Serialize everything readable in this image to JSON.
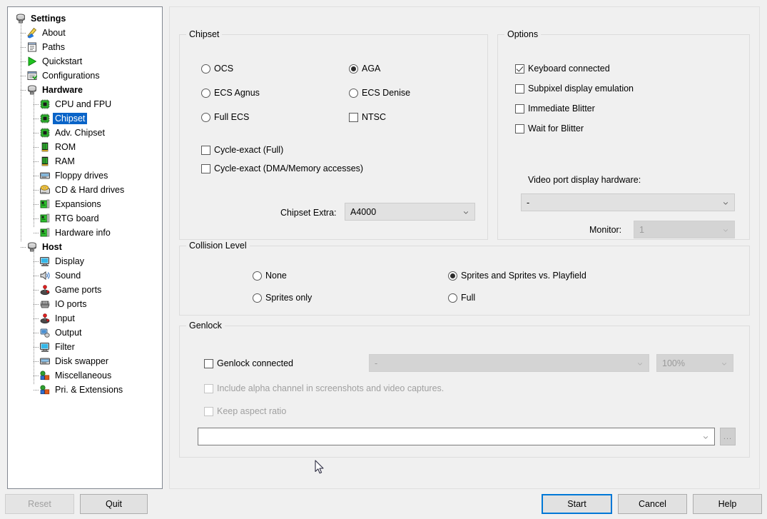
{
  "sidebar": {
    "nodes": [
      {
        "label": "Settings",
        "level": 0,
        "icon": "settings-stack-icon",
        "bold": true,
        "selected": false
      },
      {
        "label": "About",
        "level": 1,
        "icon": "about-pencil-icon",
        "bold": false,
        "selected": false
      },
      {
        "label": "Paths",
        "level": 1,
        "icon": "paths-icon",
        "bold": false,
        "selected": false
      },
      {
        "label": "Quickstart",
        "level": 1,
        "icon": "quickstart-play-icon",
        "bold": false,
        "selected": false
      },
      {
        "label": "Configurations",
        "level": 1,
        "icon": "configurations-icon",
        "bold": false,
        "selected": false
      },
      {
        "label": "Hardware",
        "level": 1,
        "icon": "hardware-stack-icon",
        "bold": true,
        "selected": false
      },
      {
        "label": "CPU and FPU",
        "level": 2,
        "icon": "chip-icon",
        "bold": false,
        "selected": false
      },
      {
        "label": "Chipset",
        "level": 2,
        "icon": "chip-icon",
        "bold": false,
        "selected": true
      },
      {
        "label": "Adv. Chipset",
        "level": 2,
        "icon": "chip-icon",
        "bold": false,
        "selected": false
      },
      {
        "label": "ROM",
        "level": 2,
        "icon": "memory-stick-icon",
        "bold": false,
        "selected": false
      },
      {
        "label": "RAM",
        "level": 2,
        "icon": "memory-stick-icon",
        "bold": false,
        "selected": false
      },
      {
        "label": "Floppy drives",
        "level": 2,
        "icon": "floppy-drive-icon",
        "bold": false,
        "selected": false
      },
      {
        "label": "CD & Hard drives",
        "level": 2,
        "icon": "cd-drive-icon",
        "bold": false,
        "selected": false
      },
      {
        "label": "Expansions",
        "level": 2,
        "icon": "expansion-card-icon",
        "bold": false,
        "selected": false
      },
      {
        "label": "RTG board",
        "level": 2,
        "icon": "expansion-card-icon",
        "bold": false,
        "selected": false
      },
      {
        "label": "Hardware info",
        "level": 2,
        "icon": "expansion-card-icon",
        "bold": false,
        "selected": false
      },
      {
        "label": "Host",
        "level": 1,
        "icon": "host-stack-icon",
        "bold": true,
        "selected": false
      },
      {
        "label": "Display",
        "level": 2,
        "icon": "monitor-icon",
        "bold": false,
        "selected": false
      },
      {
        "label": "Sound",
        "level": 2,
        "icon": "sound-icon",
        "bold": false,
        "selected": false
      },
      {
        "label": "Game ports",
        "level": 2,
        "icon": "joystick-icon",
        "bold": false,
        "selected": false
      },
      {
        "label": "IO ports",
        "level": 2,
        "icon": "io-ports-icon",
        "bold": false,
        "selected": false
      },
      {
        "label": "Input",
        "level": 2,
        "icon": "joystick-icon",
        "bold": false,
        "selected": false
      },
      {
        "label": "Output",
        "level": 2,
        "icon": "output-icon",
        "bold": false,
        "selected": false
      },
      {
        "label": "Filter",
        "level": 2,
        "icon": "monitor-icon",
        "bold": false,
        "selected": false
      },
      {
        "label": "Disk swapper",
        "level": 2,
        "icon": "floppy-drive-icon",
        "bold": false,
        "selected": false
      },
      {
        "label": "Miscellaneous",
        "level": 2,
        "icon": "blocks-icon",
        "bold": false,
        "selected": false
      },
      {
        "label": "Pri. & Extensions",
        "level": 2,
        "icon": "blocks-icon",
        "bold": false,
        "selected": false
      }
    ]
  },
  "chipset_group": {
    "title": "Chipset",
    "radios": [
      {
        "label": "OCS",
        "checked": false
      },
      {
        "label": "ECS Agnus",
        "checked": false
      },
      {
        "label": "Full ECS",
        "checked": false
      },
      {
        "label": "AGA",
        "checked": true
      },
      {
        "label": "ECS Denise",
        "checked": false
      }
    ],
    "ntsc": {
      "label": "NTSC",
      "checked": false
    },
    "cycle_exact_full": {
      "label": "Cycle-exact (Full)",
      "checked": false
    },
    "cycle_exact_dma": {
      "label": "Cycle-exact (DMA/Memory accesses)",
      "checked": false
    },
    "chipset_extra_label": "Chipset Extra:",
    "chipset_extra_value": "A4000"
  },
  "options_group": {
    "title": "Options",
    "checks": [
      {
        "label": "Keyboard connected",
        "checked": true
      },
      {
        "label": "Subpixel display emulation",
        "checked": false
      },
      {
        "label": "Immediate Blitter",
        "checked": false
      },
      {
        "label": "Wait for Blitter",
        "checked": false
      }
    ],
    "video_port_label": "Video port display hardware:",
    "video_port_value": "-",
    "monitor_label": "Monitor:",
    "monitor_value": "1"
  },
  "collision_group": {
    "title": "Collision Level",
    "radios": [
      {
        "label": "None",
        "checked": false
      },
      {
        "label": "Sprites only",
        "checked": false
      },
      {
        "label": "Sprites and Sprites vs. Playfield",
        "checked": true
      },
      {
        "label": "Full",
        "checked": false
      }
    ]
  },
  "genlock_group": {
    "title": "Genlock",
    "connected": {
      "label": "Genlock connected",
      "checked": false
    },
    "device_value": "-",
    "mix_value": "100%",
    "alpha": {
      "label": "Include alpha channel in screenshots and video captures.",
      "checked": false
    },
    "aspect": {
      "label": "Keep aspect ratio",
      "checked": false
    },
    "file_value": "",
    "browse_label": "..."
  },
  "footer": {
    "reset_label": "Reset",
    "quit_label": "Quit",
    "start_label": "Start",
    "cancel_label": "Cancel",
    "help_label": "Help"
  },
  "colors": {
    "window_bg": "#f0f0f0",
    "selection_blue": "#0a64c8",
    "focus_blue": "#0078d7",
    "group_border": "#dcdcdc"
  }
}
